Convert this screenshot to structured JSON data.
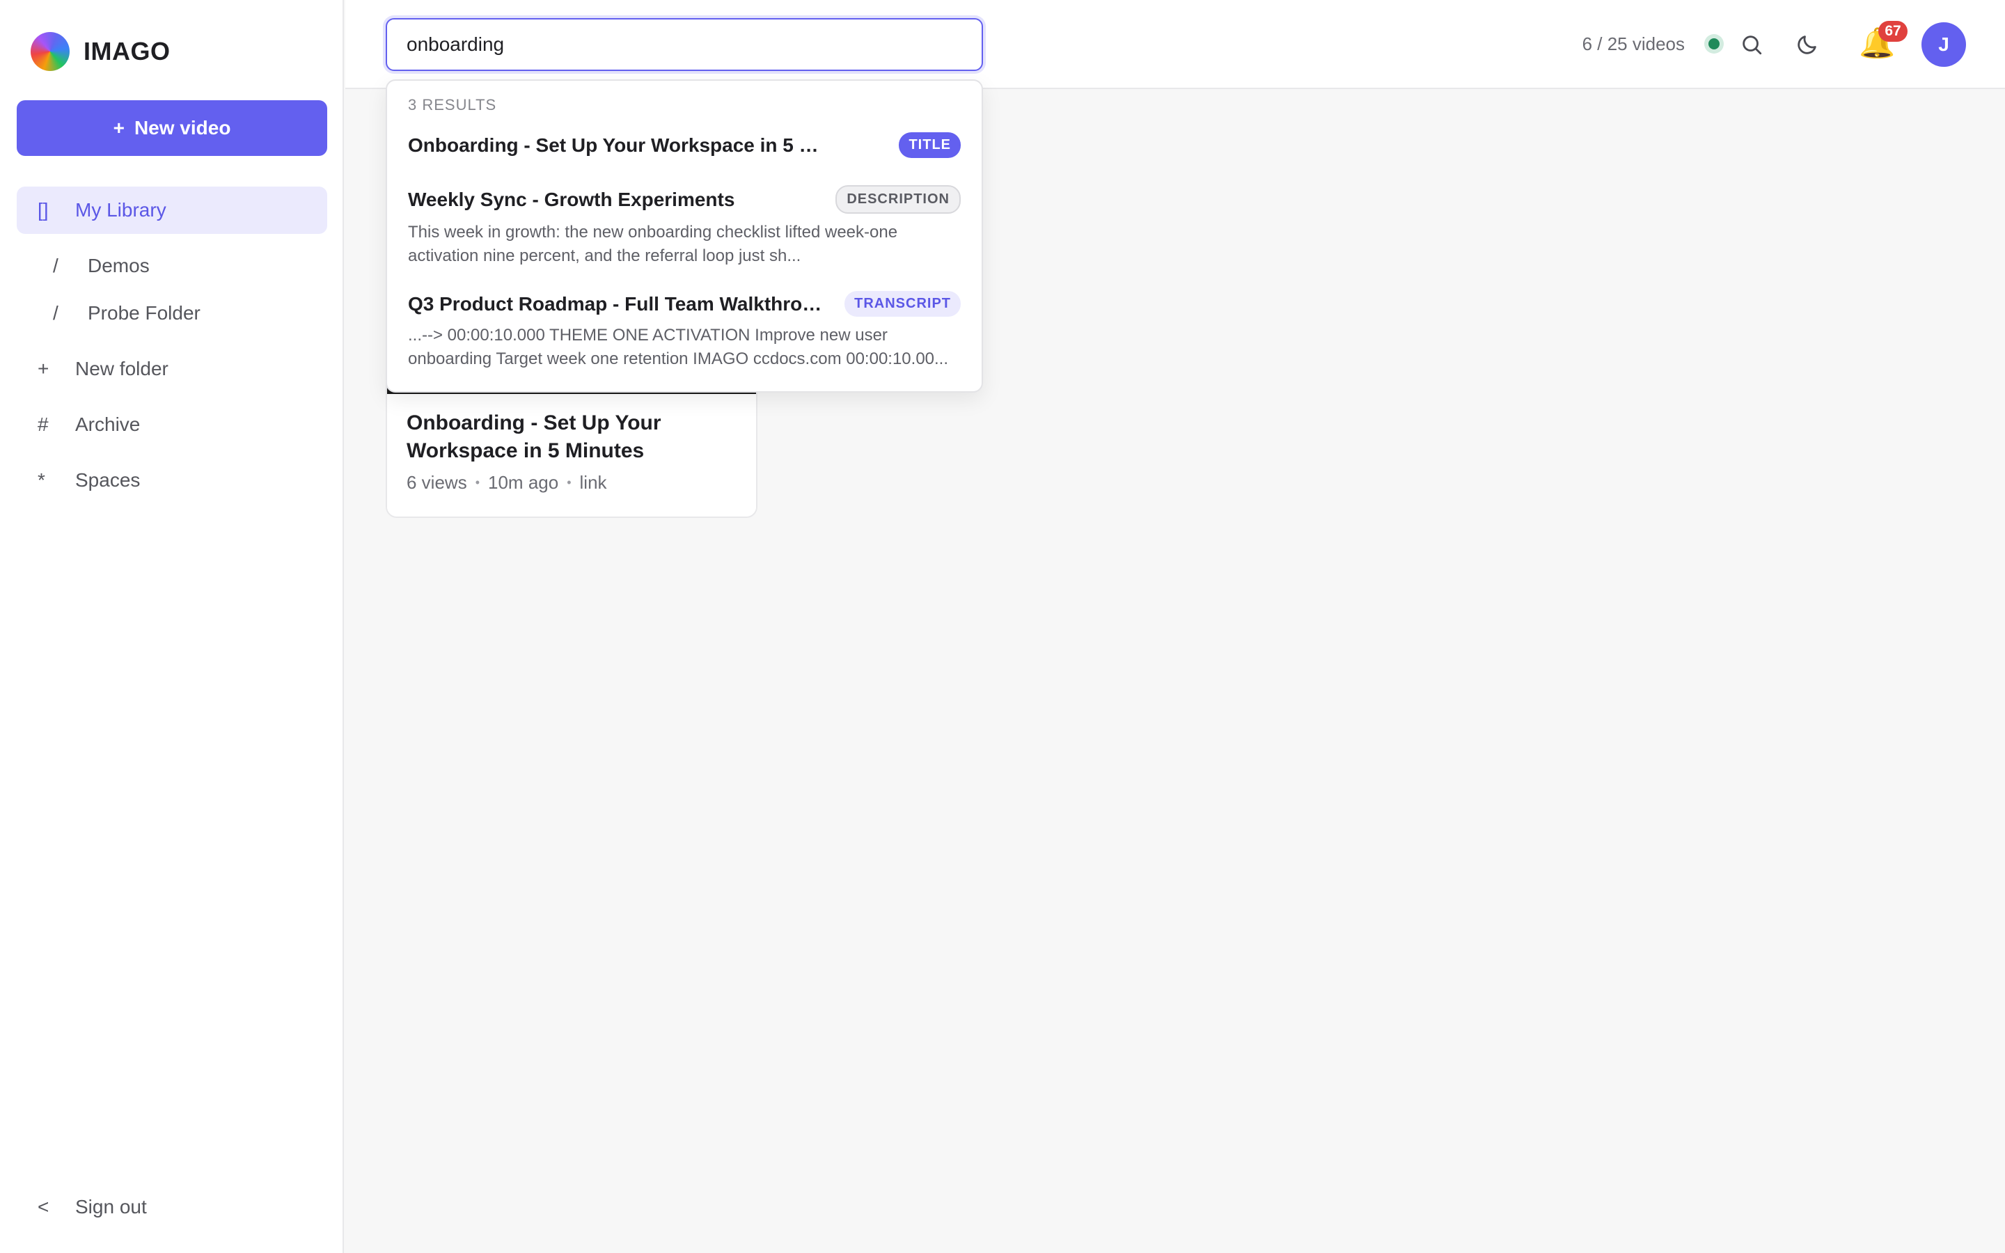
{
  "brand": {
    "name": "IMAGO"
  },
  "sidebar": {
    "new_video_icon": "+",
    "new_video_label": "New video",
    "items": [
      {
        "glyph": "[]",
        "label": "My Library",
        "active": true
      },
      {
        "glyph": "/",
        "label": "Demos"
      },
      {
        "glyph": "/",
        "label": "Probe Folder"
      },
      {
        "glyph": "+",
        "label": "New folder"
      },
      {
        "glyph": "#",
        "label": "Archive"
      },
      {
        "glyph": "*",
        "label": "Spaces"
      }
    ],
    "sign_out": {
      "glyph": "<",
      "label": "Sign out"
    }
  },
  "header": {
    "search_value": "onboarding",
    "quota": "6 / 25 videos",
    "notifications_count": "67",
    "avatar_initial": "J",
    "icons": [
      "status-dot",
      "search-icon",
      "moon-icon",
      "bell-icon"
    ]
  },
  "search_results": {
    "count_label": "3 RESULTS",
    "results": [
      {
        "title": "Onboarding - Set Up Your Workspace in 5 Minutes",
        "badge": "TITLE",
        "snippet": ""
      },
      {
        "title": "Weekly Sync - Growth Experiments",
        "badge": "DESCRIPTION",
        "snippet": "This week in growth: the new onboarding checklist lifted week-one activation nine percent, and the referral loop just sh..."
      },
      {
        "title": "Q3 Product Roadmap - Full Team Walkthro…",
        "badge": "TRANSCRIPT",
        "snippet": "...--> 00:00:10.000 THEME ONE ACTIVATION Improve new user onboarding Target week one retention IMAGO ccdocs.com 00:00:10.00..."
      }
    ]
  },
  "video_card": {
    "title": "Onboarding - Set Up Your Workspace in 5 Minutes",
    "views": "6 views",
    "age": "10m ago",
    "visibility": "link"
  },
  "colors": {
    "accent": "#6360ef",
    "accent_soft": "#ebeafd",
    "badge_red": "#e0413e",
    "status_green": "#1f8a5a"
  }
}
